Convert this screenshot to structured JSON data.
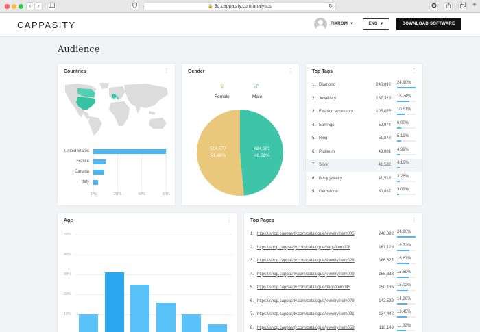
{
  "browser": {
    "url": "3d.cappasity.com/analytics",
    "back": "‹",
    "forward": "›"
  },
  "header": {
    "logo": "CAPPASITY",
    "username": "FIXROM",
    "language": "ENG",
    "download_label": "DOWNLOAD SOFTWARE"
  },
  "page_title": "Audience",
  "countries": {
    "title": "Countries",
    "axis": [
      "0%",
      "20%",
      "40%",
      "60%"
    ],
    "items": [
      {
        "name": "United States",
        "value": 60
      },
      {
        "name": "France",
        "value": 10
      },
      {
        "name": "Canada",
        "value": 9
      },
      {
        "name": "Italy",
        "value": 4
      }
    ]
  },
  "gender": {
    "title": "Gender",
    "female_label": "Female",
    "male_label": "Male",
    "female_icon": "♀",
    "male_icon": "♂",
    "female_value": "514,577",
    "female_pct": "51.48%",
    "male_value": "484,991",
    "male_pct": "48.52%",
    "female_color": "#e9c87b",
    "male_color": "#3ec5a8"
  },
  "top_tags": {
    "title": "Top Tags",
    "rows": [
      {
        "n": "1.",
        "name": "Diamond",
        "value": "248,892",
        "pct": "24.90%",
        "fill": 0.249
      },
      {
        "n": "2.",
        "name": "Jewellery",
        "value": "167,328",
        "pct": "16.74%",
        "fill": 0.167
      },
      {
        "n": "3.",
        "name": "Fashion accessory",
        "value": "105,055",
        "pct": "10.51%",
        "fill": 0.105
      },
      {
        "n": "4.",
        "name": "Earrings",
        "value": "59,974",
        "pct": "6.00%",
        "fill": 0.06
      },
      {
        "n": "5.",
        "name": "Ring",
        "value": "51,878",
        "pct": "5.19%",
        "fill": 0.052
      },
      {
        "n": "6.",
        "name": "Platinum",
        "value": "43,881",
        "pct": "4.39%",
        "fill": 0.044
      },
      {
        "n": "7.",
        "name": "Silver",
        "value": "41,582",
        "pct": "4.16%",
        "fill": 0.042
      },
      {
        "n": "8.",
        "name": "Body jewelry",
        "value": "41,516",
        "pct": "3.26%",
        "fill": 0.033
      },
      {
        "n": "9.",
        "name": "Gemstone",
        "value": "30,887",
        "pct": "3.09%",
        "fill": 0.031
      }
    ]
  },
  "age": {
    "title": "Age",
    "y_ticks": [
      "50%",
      "40%",
      "30%",
      "20%",
      "10%"
    ],
    "bars": [
      10,
      31,
      25,
      16,
      10,
      5
    ]
  },
  "top_pages": {
    "title": "Top Pages",
    "rows": [
      {
        "n": "1.",
        "url": "https://shop.cappasity.com/catalogue/jewelry/item005",
        "value": "248,892",
        "pct": "24.90%",
        "fill": 0.249
      },
      {
        "n": "2.",
        "url": "https://shop.cappasity.com/catalogue/bags/item008",
        "value": "167,128",
        "pct": "16.72%",
        "fill": 0.167
      },
      {
        "n": "3.",
        "url": "https://shop.cappasity.com/catalogue/jewelry/item028",
        "value": "166,627",
        "pct": "16.67%",
        "fill": 0.167
      },
      {
        "n": "4.",
        "url": "https://shop.cappasity.com/catalogue/jewelry/item009",
        "value": "155,833",
        "pct": "15.59%",
        "fill": 0.156
      },
      {
        "n": "5.",
        "url": "https://shop.cappasity.com/catalogue/bags/item045",
        "value": "150,135",
        "pct": "15.02%",
        "fill": 0.15
      },
      {
        "n": "6.",
        "url": "https://shop.cappasity.com/catalogue/jewelry/item079",
        "value": "142,538",
        "pct": "14.26%",
        "fill": 0.143
      },
      {
        "n": "7.",
        "url": "https://shop.cappasity.com/catalogue/jewelry/item021",
        "value": "134,442",
        "pct": "13.45%",
        "fill": 0.135
      },
      {
        "n": "8.",
        "url": "https://shop.cappasity.com/catalogue/jewelry/item058",
        "value": "118,149",
        "pct": "11.82%",
        "fill": 0.118
      }
    ]
  },
  "icons": {
    "kebab": "⋮",
    "caret": "▼"
  }
}
